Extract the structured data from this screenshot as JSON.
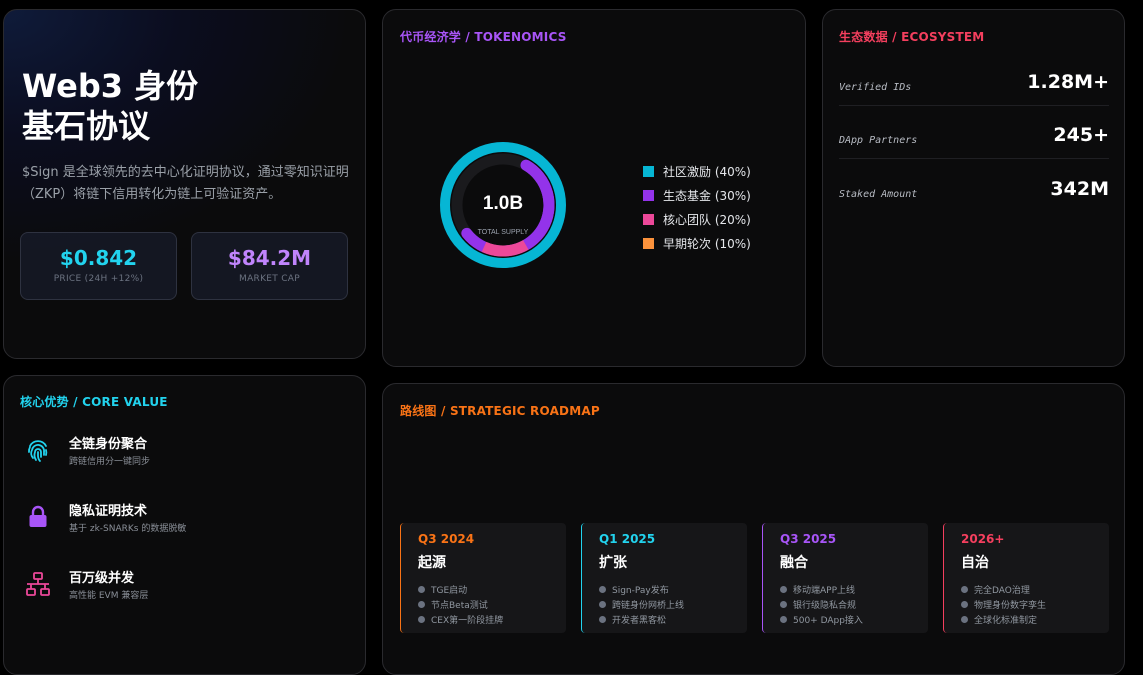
{
  "hero": {
    "title_line1": "Web3 身份",
    "title_line2": "基石协议",
    "description": "$Sign 是全球领先的去中心化证明协议，通过零知识证明（ZKP）将链下信用转化为链上可验证资产。",
    "price": {
      "value": "$0.842",
      "label": "PRICE (24H +12%)",
      "color": "#22d3ee"
    },
    "market_cap": {
      "value": "$84.2M",
      "label": "MARKET CAP",
      "color": "#c084fc"
    }
  },
  "tokenomics": {
    "title": "代币经济学 / TOKENOMICS",
    "title_color": "#a855f7",
    "total": "1.0B",
    "total_label": "TOTAL SUPPLY",
    "legend": [
      {
        "label": "社区激励 (40%)",
        "color": "#06b6d4"
      },
      {
        "label": "生态基金 (30%)",
        "color": "#9333ea"
      },
      {
        "label": "核心团队 (20%)",
        "color": "#ec4899"
      },
      {
        "label": "早期轮次 (10%)",
        "color": "#fb923c"
      }
    ]
  },
  "chart_data": {
    "type": "pie",
    "categories": [
      "社区激励",
      "生态基金",
      "核心团队",
      "早期轮次"
    ],
    "values": [
      40,
      30,
      20,
      10
    ],
    "title": "代币经济学 / TOKENOMICS",
    "center_label": "1.0B",
    "center_sublabel": "TOTAL SUPPLY",
    "ring_segments": [
      {
        "name": "outer",
        "values": [
          70,
          30
        ],
        "colors": [
          "#06b6d4",
          "#06b6d4"
        ]
      },
      {
        "name": "inner",
        "values": [
          0.8,
          0.2,
          0.45
        ],
        "colors": [
          "#06b6d4",
          "#9333ea",
          "#ec4899"
        ]
      }
    ]
  },
  "ecosystem": {
    "title": "生态数据 / ECOSYSTEM",
    "title_color": "#f43f5e",
    "rows": [
      {
        "label": "Verified IDs",
        "value": "1.28M+"
      },
      {
        "label": "DApp Partners",
        "value": "245+"
      },
      {
        "label": "Staked Amount",
        "value": "342M"
      }
    ]
  },
  "core": {
    "title": "核心优势 / CORE VALUE",
    "title_color": "#22d3ee",
    "items": [
      {
        "title": "全链身份聚合",
        "subtitle": "跨链信用分一键同步",
        "icon": "fingerprint-icon",
        "color": "#22d3ee"
      },
      {
        "title": "隐私证明技术",
        "subtitle": "基于 zk-SNARKs 的数据脱敏",
        "icon": "lock-icon",
        "color": "#a855f7"
      },
      {
        "title": "百万级并发",
        "subtitle": "高性能 EVM 兼容层",
        "icon": "network-icon",
        "color": "#ec4899"
      }
    ]
  },
  "roadmap": {
    "title": "路线图 / STRATEGIC ROADMAP",
    "title_color": "#f97316",
    "phases": [
      {
        "period": "Q3 2024",
        "name": "起源",
        "color": "#f97316",
        "items": [
          "TGE启动",
          "节点Beta测试",
          "CEX第一阶段挂牌"
        ]
      },
      {
        "period": "Q1 2025",
        "name": "扩张",
        "color": "#22d3ee",
        "items": [
          "Sign-Pay发布",
          "跨链身份网桥上线",
          "开发者黑客松"
        ]
      },
      {
        "period": "Q3 2025",
        "name": "融合",
        "color": "#a855f7",
        "items": [
          "移动端APP上线",
          "银行级隐私合规",
          "500+ DApp接入"
        ]
      },
      {
        "period": "2026+",
        "name": "自治",
        "color": "#f43f5e",
        "items": [
          "完全DAO治理",
          "物理身份数字孪生",
          "全球化标准制定"
        ]
      }
    ]
  }
}
